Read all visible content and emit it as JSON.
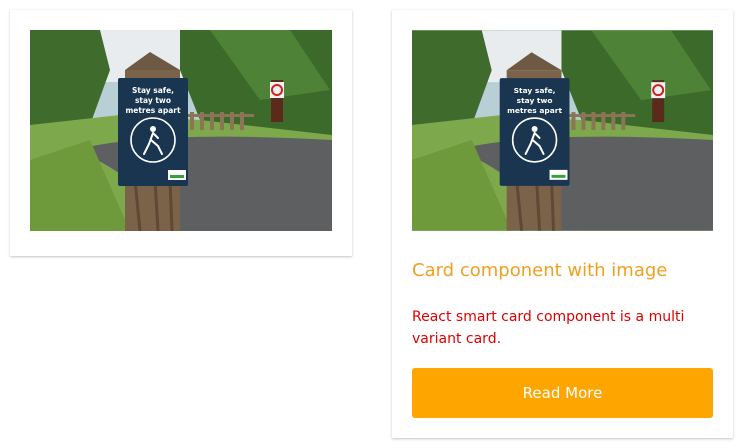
{
  "cards": [
    {
      "image": {
        "alt": "Sign on wooden post by a park path",
        "sign_lines": [
          "Stay safe,",
          "stay two",
          "metres apart"
        ]
      }
    },
    {
      "image": {
        "alt": "Sign on wooden post by a park path",
        "sign_lines": [
          "Stay safe,",
          "stay two",
          "metres apart"
        ]
      },
      "title": "Card component with image",
      "text": "React smart card component is a multi variant card.",
      "button_label": "Read More"
    }
  ],
  "colors": {
    "title": "#f0a020",
    "text": "#dd0000",
    "button_bg": "#ffa500",
    "button_text": "#ffffff"
  }
}
